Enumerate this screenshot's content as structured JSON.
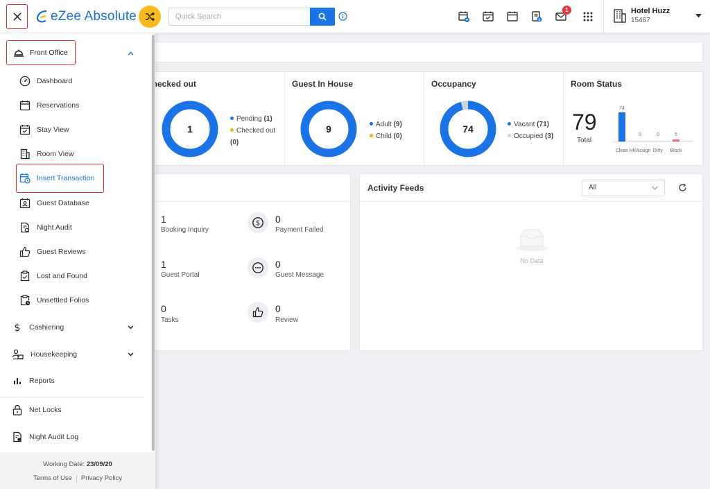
{
  "app": {
    "name": "eZee Absolute"
  },
  "search": {
    "placeholder": "Quick Search"
  },
  "hotel": {
    "name": "Hotel Huzz",
    "code": "15467"
  },
  "notifications": {
    "mail_count": "1"
  },
  "icons": {
    "close": "close-icon",
    "shuffle": "shuffle-icon",
    "search": "search-icon",
    "info": "info-icon",
    "top": [
      "calendar-add-icon",
      "calendar-check-icon",
      "calendar-icon",
      "invoice-icon",
      "mail-icon",
      "apps-grid-icon"
    ],
    "hotel": "building-icon"
  },
  "colors": {
    "accent": "#1b73e8",
    "highlight": "#e3262a",
    "shuffle": "#f8b91f",
    "donut": "#1b73e8",
    "yellow": "#f5b400",
    "grey": "#d0d3d8",
    "block": "#f26d6d"
  },
  "sidebar": {
    "front_office": "Front Office",
    "items": [
      {
        "label": "Dashboard",
        "icon": "gauge-icon"
      },
      {
        "label": "Reservations",
        "icon": "calendar-icon"
      },
      {
        "label": "Stay View",
        "icon": "calendar-check-icon"
      },
      {
        "label": "Room View",
        "icon": "building-icon"
      },
      {
        "label": "Insert Transaction",
        "icon": "calendar-clock-icon",
        "active": true
      },
      {
        "label": "Guest Database",
        "icon": "contact-card-icon"
      },
      {
        "label": "Night Audit",
        "icon": "audit-file-icon"
      },
      {
        "label": "Guest Reviews",
        "icon": "thumbs-up-icon"
      },
      {
        "label": "Lost and Found",
        "icon": "clipboard-check-icon"
      },
      {
        "label": "Unsettled Folios",
        "icon": "clipboard-clock-icon"
      }
    ],
    "groups": [
      {
        "label": "Cashiering",
        "icon": "dollar-icon"
      },
      {
        "label": "Housekeeping",
        "icon": "housekeeping-icon"
      },
      {
        "label": "Reports",
        "icon": "bar-chart-icon"
      },
      {
        "label": "Net Locks",
        "icon": "lock-icon"
      },
      {
        "label": "Night Audit Log",
        "icon": "audit-log-icon"
      }
    ],
    "working_date_label": "Working Date:",
    "working_date": "23/09/20",
    "terms": "Terms of Use",
    "privacy": "Privacy Policy"
  },
  "stats": {
    "checked_out": {
      "title": "Checked out",
      "center": "1",
      "legend": [
        {
          "label": "Pending",
          "value": "(1)",
          "color": "#1b73e8"
        },
        {
          "label": "Checked out",
          "value": "(0)",
          "color": "#f5b400"
        }
      ]
    },
    "guest_in_house": {
      "title": "Guest In House",
      "center": "9",
      "legend": [
        {
          "label": "Adult",
          "value": "(9)",
          "color": "#1b73e8"
        },
        {
          "label": "Child",
          "value": "(0)",
          "color": "#f5b400"
        }
      ]
    },
    "occupancy": {
      "title": "Occupancy",
      "center": "74",
      "legend": [
        {
          "label": "Vacant",
          "value": "(71)",
          "color": "#1b73e8"
        },
        {
          "label": "Occupied",
          "value": "(3)",
          "color": "#d0d3d8"
        }
      ]
    },
    "room_status": {
      "title": "Room Status",
      "total": "79",
      "total_label": "Total"
    }
  },
  "counters": [
    {
      "count": "1",
      "label": "Booking Inquiry"
    },
    {
      "count": "0",
      "label": "Payment Failed",
      "icon": "dollar-circle-icon"
    },
    {
      "count": "1",
      "label": "Guest Portal"
    },
    {
      "count": "0",
      "label": "Guest Message",
      "icon": "chat-icon"
    },
    {
      "count": "0",
      "label": "Tasks"
    },
    {
      "count": "0",
      "label": "Review",
      "icon": "thumbs-up-icon"
    }
  ],
  "activity": {
    "title": "Activity Feeds",
    "filter": "All",
    "empty": "No Data"
  },
  "chart_data": {
    "type": "bar",
    "title": "Room Status",
    "categories": [
      "Clean",
      "HKAssign",
      "Dirty",
      "Block"
    ],
    "values": [
      74,
      0,
      0,
      5
    ],
    "value_labels": [
      "74",
      "0",
      "0",
      "5"
    ],
    "colors": [
      "#1b73e8",
      "#1b73e8",
      "#1b73e8",
      "#f26d6d"
    ],
    "ylim": [
      0,
      74
    ]
  }
}
